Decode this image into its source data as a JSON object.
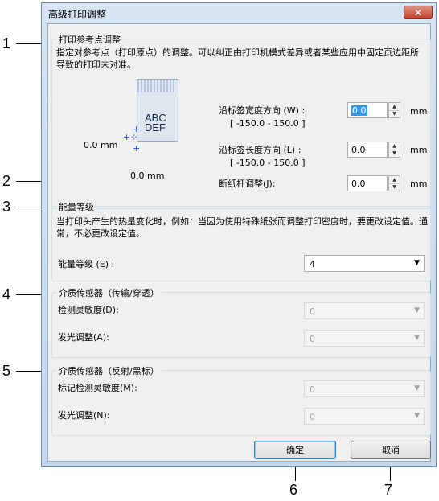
{
  "dialog": {
    "title": "高级打印调整",
    "close_glyph": "✕"
  },
  "callouts": [
    "1",
    "2",
    "3",
    "4",
    "5",
    "6",
    "7"
  ],
  "print_reference": {
    "group_title": "打印参考点调整",
    "description": "指定对参考点（打印原点）的调整。可以纠正由打印机模式差异或者某些应用中固定页边距所导致的打印未对准。",
    "preview_text": "ABC\nDEF",
    "preview_x_value": "0.0 mm",
    "preview_y_value": "0.0 mm",
    "width_label": "沿标签宽度方向 (W) :",
    "width_range": "[ -150.0 - 150.0 ]",
    "width_value": "0.0",
    "length_label": "沿标签长度方向 (L) :",
    "length_range": "[ -150.0 - 150.0 ]",
    "length_value": "0.0",
    "cutter_label": "断纸杆调整(J):",
    "cutter_value": "0.0",
    "unit": "mm"
  },
  "energy": {
    "group_title": "能量等级",
    "description": "当打印头产生的热量变化时，例如：当因为使用特殊纸张而调整打印密度时，要更改设定值。通常，不必更改设定值。",
    "label": "能量等级 (E) :",
    "value": "4"
  },
  "media_sensor_transmissive": {
    "group_title": "介质传感器（传输/穿透）",
    "sensitivity_label": "检测灵敏度(D):",
    "sensitivity_value": "0",
    "luminescence_label": "发光调整(A):",
    "luminescence_value": "0"
  },
  "media_sensor_reflective": {
    "group_title": "介质传感器（反射/黑标）",
    "sensitivity_label": "标记检测灵敏度(M):",
    "sensitivity_value": "0",
    "luminescence_label": "发光调整(N):",
    "luminescence_value": "0"
  },
  "buttons": {
    "ok": "确定",
    "cancel": "取消"
  }
}
